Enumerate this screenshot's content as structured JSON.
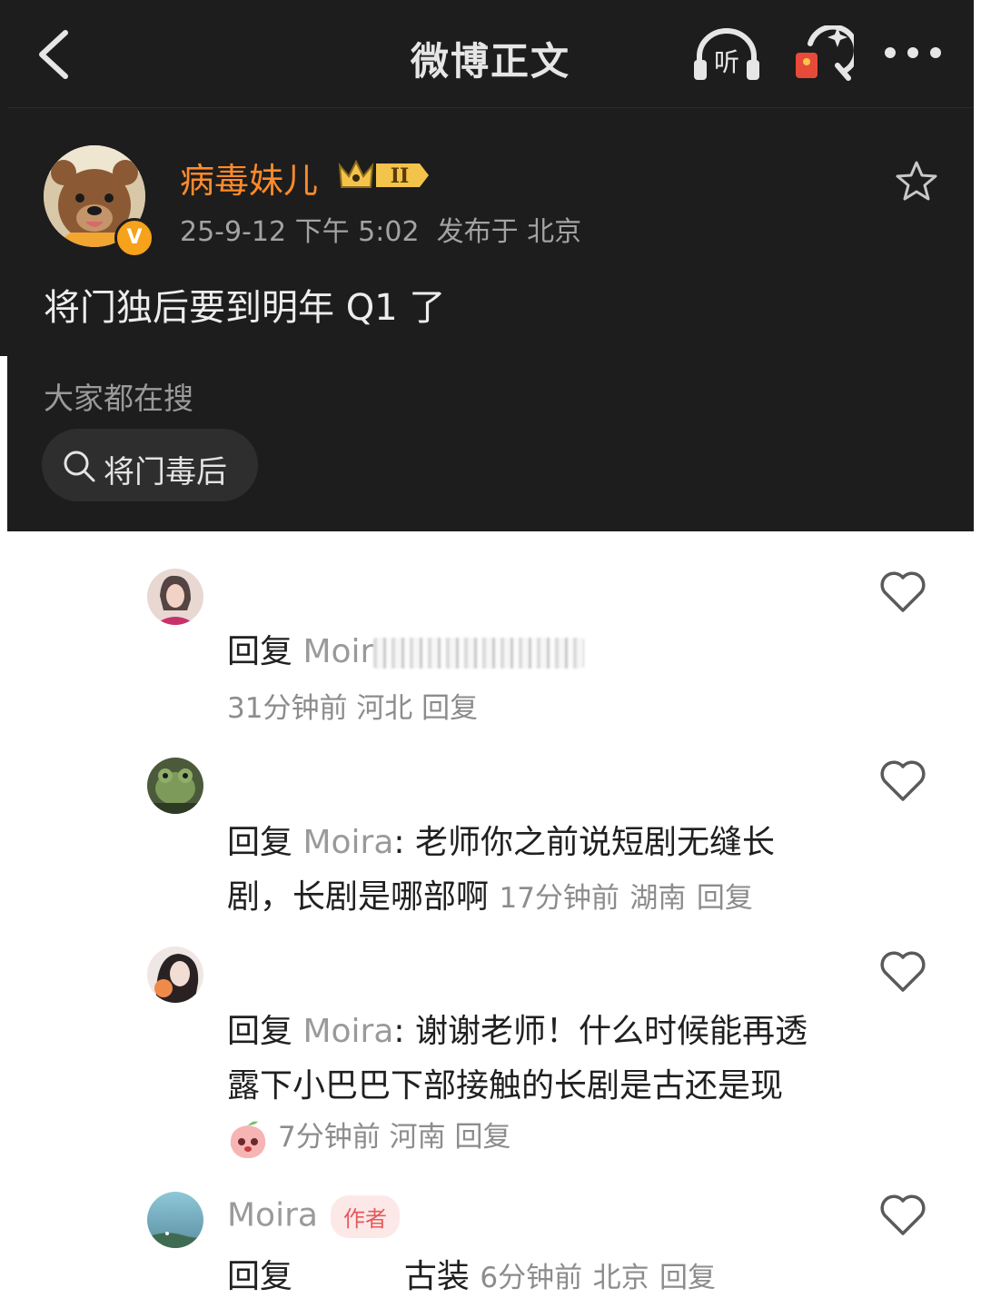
{
  "header": {
    "back_icon": "chevron-left-icon",
    "title": "微博正文",
    "listen_label": "听",
    "redpack_icon": "red-packet-icon",
    "more_icon": "more-dots-icon"
  },
  "post": {
    "author": "病毒妹儿",
    "level_badge": "II",
    "verified_badge": "V",
    "date": "25-9-12 下午 5:02",
    "location": "发布于 北京",
    "text": "将门独后要到明年 Q1 了",
    "search_hint": "大家都在搜",
    "search_chip": "将门毒后"
  },
  "comments": [
    {
      "reply_prefix": "回复",
      "reply_to": "Moir",
      "text": "",
      "time": "31分钟前",
      "region": "河北",
      "reply": "回复"
    },
    {
      "reply_prefix": "回复",
      "reply_to": "Moira",
      "text_line1": ": 老师你之前说短剧无缝长",
      "text_line2": "剧，长剧是哪部啊",
      "time": "17分钟前",
      "region": "湖南",
      "reply": "回复"
    },
    {
      "reply_prefix": "回复",
      "reply_to": "Moira",
      "text_line1": ": 谢谢老师！什么时候能再透",
      "text_line2": "露下小巴巴下部接触的长剧是古还是现",
      "time": "7分钟前",
      "region": "河南",
      "reply": "回复"
    },
    {
      "name": "Moira",
      "tag": "作者",
      "reply_prefix": "回复",
      "text": "古装",
      "time": "6分钟前",
      "region": "北京",
      "reply": "回复"
    }
  ],
  "colors": {
    "dark_bg": "#1d1d1d",
    "author_orange": "#ff8a2a",
    "author_tag_bg": "#fde8e8",
    "author_tag_fg": "#e55a5a"
  }
}
